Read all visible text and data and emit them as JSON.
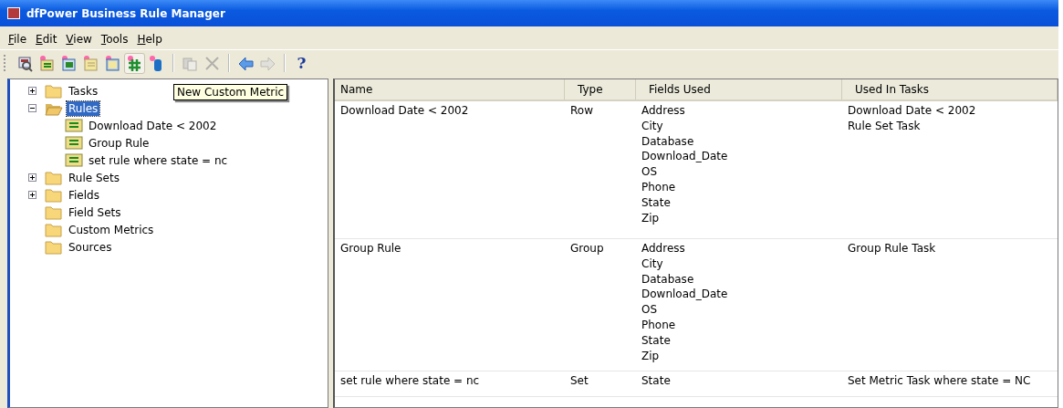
{
  "window": {
    "title": "dfPower Business Rule Manager"
  },
  "menu": [
    {
      "label": "File"
    },
    {
      "label": "Edit"
    },
    {
      "label": "View"
    },
    {
      "label": "Tools"
    },
    {
      "label": "Help"
    }
  ],
  "toolbar": [
    {
      "kind": "new-task",
      "hovered": false,
      "disabled": false
    },
    {
      "kind": "new-rule",
      "hovered": false,
      "disabled": false
    },
    {
      "kind": "new-ruleset",
      "hovered": false,
      "disabled": false
    },
    {
      "kind": "new-field",
      "hovered": false,
      "disabled": false
    },
    {
      "kind": "new-fieldset",
      "hovered": false,
      "disabled": false
    },
    {
      "kind": "new-metric",
      "hovered": true,
      "disabled": false
    },
    {
      "kind": "new-source",
      "hovered": false,
      "disabled": false
    },
    {
      "kind": "separator"
    },
    {
      "kind": "paste",
      "hovered": false,
      "disabled": true
    },
    {
      "kind": "delete",
      "hovered": false,
      "disabled": true
    },
    {
      "kind": "separator"
    },
    {
      "kind": "back",
      "hovered": false,
      "disabled": false
    },
    {
      "kind": "forward",
      "hovered": false,
      "disabled": true
    },
    {
      "kind": "separator"
    },
    {
      "kind": "help",
      "label": "?",
      "hovered": false,
      "disabled": false
    }
  ],
  "tooltip": "New Custom Metric",
  "tree": [
    {
      "label": "Tasks",
      "expandable": true,
      "expanded": false,
      "selected": false
    },
    {
      "label": "Rules",
      "expandable": true,
      "expanded": true,
      "selected": true,
      "children": [
        {
          "label": "Download Date < 2002",
          "selected": false
        },
        {
          "label": "Group Rule",
          "selected": false
        },
        {
          "label": "set rule where state = nc",
          "selected": false
        }
      ]
    },
    {
      "label": "Rule Sets",
      "expandable": true,
      "expanded": false,
      "selected": false
    },
    {
      "label": "Fields",
      "expandable": true,
      "expanded": false,
      "selected": false
    },
    {
      "label": "Field Sets",
      "expandable": false,
      "expanded": false,
      "selected": false
    },
    {
      "label": "Custom Metrics",
      "expandable": false,
      "expanded": false,
      "selected": false
    },
    {
      "label": "Sources",
      "expandable": false,
      "expanded": false,
      "selected": false
    }
  ],
  "table": {
    "columns": [
      "Name",
      "Type",
      "Fields Used",
      "Used In Tasks"
    ],
    "rows": [
      {
        "name": "Download Date < 2002",
        "type": "Row",
        "fields": [
          "Address",
          "City",
          "Database",
          "Download_Date",
          "OS",
          "Phone",
          "State",
          "Zip"
        ],
        "tasks": [
          "Download Date < 2002",
          "Rule Set Task"
        ]
      },
      {
        "name": "Group Rule",
        "type": "Group",
        "fields": [
          "Address",
          "City",
          "Database",
          "Download_Date",
          "OS",
          "Phone",
          "State",
          "Zip"
        ],
        "tasks": [
          "Group Rule Task"
        ]
      },
      {
        "name": "set rule where state = nc",
        "type": "Set",
        "fields": [
          "State"
        ],
        "tasks": [
          "Set Metric Task where state = NC"
        ]
      }
    ]
  }
}
